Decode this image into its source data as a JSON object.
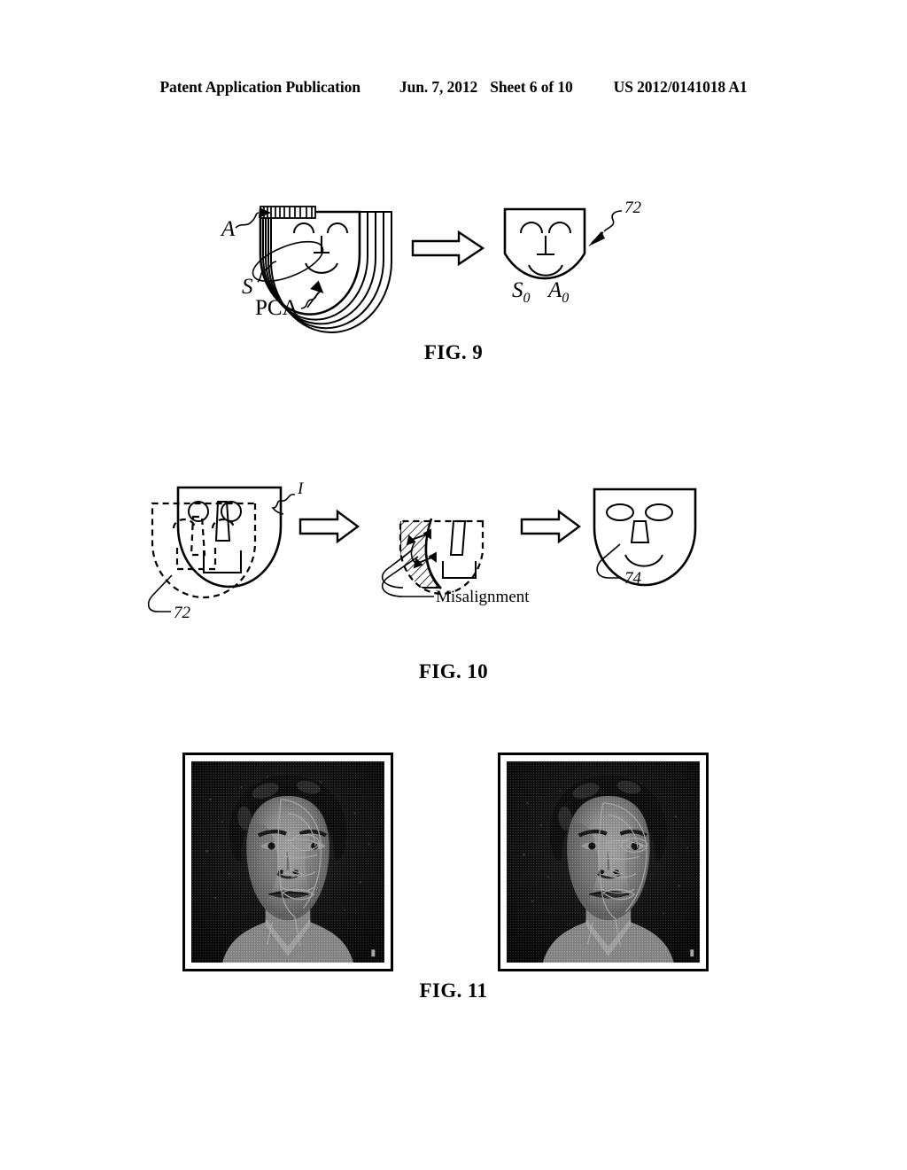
{
  "header": {
    "publication": "Patent Application Publication",
    "date": "Jun. 7, 2012",
    "sheet": "Sheet 6 of 10",
    "doc_number": "US 2012/0141018 A1"
  },
  "figures": [
    {
      "id": "fig9",
      "caption": "FIG. 9",
      "labels": {
        "appearance": "A",
        "shape": "S",
        "pca": "PCA",
        "result_ref": "72",
        "mean_shape": "S",
        "mean_shape_sub": "0",
        "mean_appearance": "A",
        "mean_appearance_sub": "0"
      },
      "arrow": "block-arrow-right"
    },
    {
      "id": "fig10",
      "caption": "FIG. 10",
      "labels": {
        "input_image": "I",
        "model_ref": "72",
        "misalignment": "Misalignment",
        "output_ref": "74"
      },
      "arrows": [
        "block-arrow-right",
        "block-arrow-right"
      ]
    },
    {
      "id": "fig11",
      "caption": "FIG. 11",
      "photos": [
        {
          "name": "left-photo",
          "alt": "face with fitted mesh overlay, initial"
        },
        {
          "name": "right-photo",
          "alt": "face with fitted mesh overlay, converged"
        }
      ]
    }
  ],
  "colors": {
    "ink": "#000000",
    "paper": "#ffffff"
  }
}
